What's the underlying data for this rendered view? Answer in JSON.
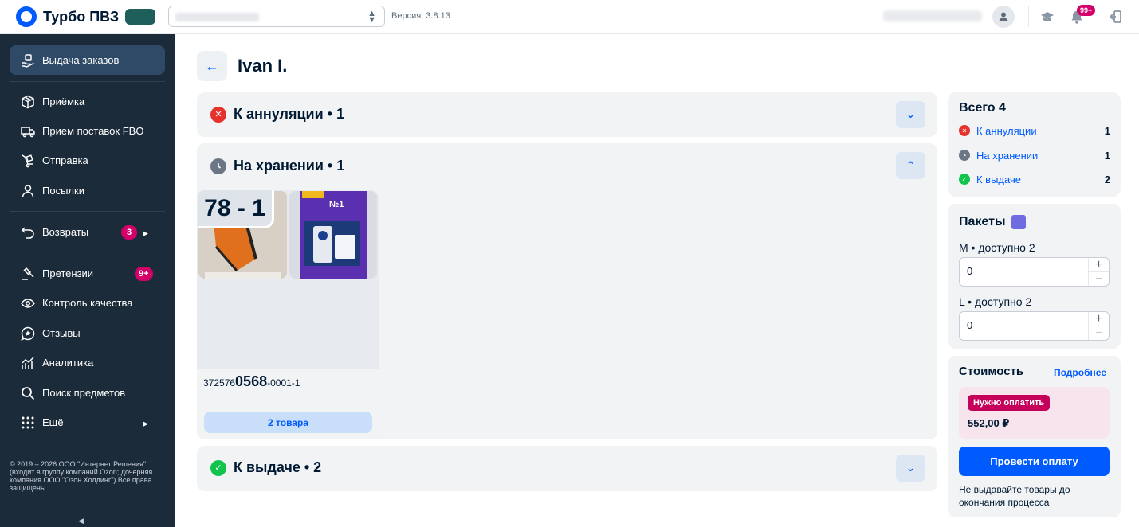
{
  "topbar": {
    "app_name": "Турбо ПВЗ",
    "version": "Версия: 3.8.13",
    "notifications_badge": "99+"
  },
  "sidebar": {
    "items": [
      {
        "label": "Выдача заказов",
        "icon": "hand-package-icon"
      },
      {
        "label": "Приёмка",
        "icon": "box-icon"
      },
      {
        "label": "Прием поставок FBO",
        "icon": "truck-icon"
      },
      {
        "label": "Отправка",
        "icon": "dolly-icon"
      },
      {
        "label": "Посылки",
        "icon": "person-icon"
      },
      {
        "label": "Возвраты",
        "icon": "return-icon",
        "badge": "3"
      },
      {
        "label": "Претензии",
        "icon": "gavel-icon",
        "badge": "9+"
      },
      {
        "label": "Контроль качества",
        "icon": "eye-icon"
      },
      {
        "label": "Отзывы",
        "icon": "star-chat-icon"
      },
      {
        "label": "Аналитика",
        "icon": "chart-icon"
      },
      {
        "label": "Поиск предметов",
        "icon": "search-icon"
      },
      {
        "label": "Ещё",
        "icon": "dots-grid-icon"
      }
    ],
    "copyright": "© 2019 – 2026 ООО \"Интернет Решения\" (входит в группу компаний Ozon; дочерняя компания ООО \"Озон Холдинг\") Все права защищены."
  },
  "page": {
    "title": "Ivan I."
  },
  "groups": {
    "cancel": {
      "title": "К аннуляции • 1"
    },
    "storage": {
      "title": "На хранении • 1"
    },
    "issue": {
      "title": "К выдаче • 2"
    }
  },
  "card": {
    "cell": "78 - 1",
    "barcode_prefix": "372576",
    "barcode_main": "0568",
    "barcode_suffix": "-0001-1",
    "items_button": "2 товара"
  },
  "summary": {
    "title": "Всего 4",
    "rows": [
      {
        "label": "К аннуляции",
        "count": "1",
        "color": "#e5322d"
      },
      {
        "label": "На хранении",
        "count": "1",
        "color": "#6b7785"
      },
      {
        "label": "К выдаче",
        "count": "2",
        "color": "#10c44c"
      }
    ]
  },
  "packages": {
    "title": "Пакеты",
    "m_label": "M • доступно 2",
    "m_value": "0",
    "l_label": "L • доступно 2",
    "l_value": "0"
  },
  "cost": {
    "title": "Стоимость",
    "more_link": "Подробнее",
    "badge": "Нужно оплатить",
    "amount": "552,00 ₽",
    "pay_button": "Провести оплату",
    "warning": "Не выдавайте товары до окончания процесса"
  }
}
